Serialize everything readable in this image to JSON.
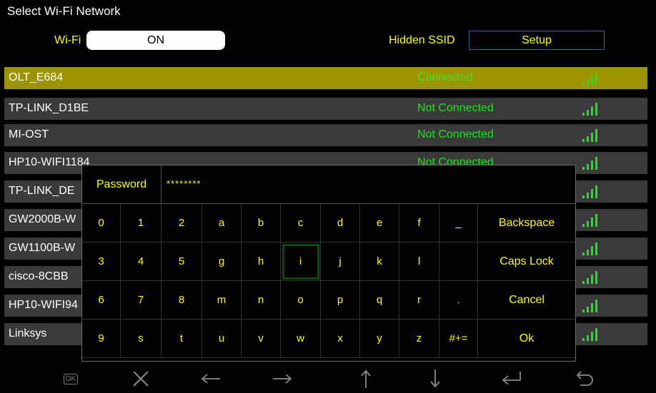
{
  "header": {
    "title": "Select Wi-Fi Network",
    "wifi_label": "Wi-Fi",
    "wifi_state": "ON",
    "hidden_ssid_label": "Hidden SSID",
    "setup_label": "Setup"
  },
  "networks": [
    {
      "ssid": "OLT_E684",
      "status": "Connected",
      "active": true
    },
    {
      "ssid": "TP-LINK_D1BE",
      "status": "Not Connected"
    },
    {
      "ssid": "MI-OST",
      "status": "Not Connected"
    },
    {
      "ssid": "HP10-WIFI1184",
      "status": "Not Connected"
    },
    {
      "ssid": "TP-LINK_DE",
      "status": ""
    },
    {
      "ssid": "GW2000B-W",
      "status": ""
    },
    {
      "ssid": "GW1100B-W",
      "status": ""
    },
    {
      "ssid": "cisco-8CBB",
      "status": ""
    },
    {
      "ssid": "HP10-WIFI94",
      "status": ""
    },
    {
      "ssid": "Linksys",
      "status": ""
    }
  ],
  "keyboard": {
    "password_label": "Password",
    "password_value": "********",
    "rows": [
      [
        "0",
        "1",
        "2",
        "a",
        "b",
        "c",
        "d",
        "e",
        "f",
        "_"
      ],
      [
        "3",
        "4",
        "5",
        "g",
        "h",
        "i",
        "j",
        "k",
        "l",
        ""
      ],
      [
        "6",
        "7",
        "8",
        "m",
        "n",
        "o",
        "p",
        "q",
        "r",
        "."
      ],
      [
        "9",
        "s",
        "t",
        "u",
        "v",
        "w",
        "x",
        "y",
        "z",
        "#+="
      ]
    ],
    "actions": [
      "Backspace",
      "Caps Lock",
      "Cancel",
      "Ok"
    ],
    "selected_key": "i"
  },
  "bottom_bar": {
    "ok_label": "OK",
    "icons": [
      "ok-icon",
      "close-icon",
      "arrow-left-icon",
      "arrow-right-icon",
      "arrow-up-icon",
      "arrow-down-icon",
      "enter-icon",
      "back-icon"
    ]
  },
  "colors": {
    "active_row": "#9c9500",
    "row": "#3a3a3a",
    "text_accent": "#ffff00",
    "status_green": "#19e619"
  }
}
